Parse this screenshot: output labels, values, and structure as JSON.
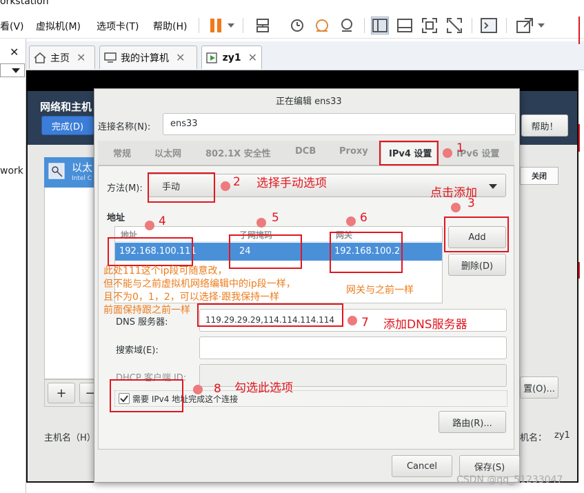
{
  "app_title": "orkstation",
  "menu": [
    {
      "label": "看(V)"
    },
    {
      "label": "虚拟机(M)"
    },
    {
      "label": "选项卡(T)"
    },
    {
      "label": "帮助(H)"
    }
  ],
  "toolbar_icons": [
    "pause-icon",
    "dropdown-icon",
    "send-keys-icon",
    "snapshot-icon",
    "revert-snapshot-icon",
    "snapshot-manager-icon",
    "sidebar-view-icon",
    "thumbnail-view-icon",
    "fullscreen-icon",
    "unity-icon",
    "console-icon",
    "stretch-icon",
    "dropdown-icon"
  ],
  "tabs": [
    {
      "label": "主页"
    },
    {
      "label": "我的计算机"
    },
    {
      "label": "zy1"
    }
  ],
  "left_text": "work",
  "settings_panel": {
    "header_title": "网络和主机",
    "done_button": "完成(D)",
    "help_button": "帮助！",
    "device_name": "以太",
    "device_sub": "Intel C",
    "close_label": "关闭",
    "hostname_label": "主机名（H）",
    "hostname_suffix": "机名：",
    "hostname_value": "zy1",
    "configure_button": "置(O)...",
    "add_button": "+",
    "remove_button": "−"
  },
  "dialog": {
    "title": "正在编辑 ens33",
    "connection_name_label": "连接名称(N):",
    "connection_name_value": "ens33",
    "tabs": [
      "常规",
      "以太网",
      "802.1X 安全性",
      "DCB",
      "Proxy",
      "IPv4 设置",
      "IPv6 设置"
    ],
    "active_tab": "IPv4 设置",
    "method_label": "方法(M):",
    "method_value": "手动",
    "address_section": "地址",
    "columns": [
      "地址",
      "子网掩码",
      "网关"
    ],
    "address_row": {
      "address": "192.168.100.111",
      "netmask": "24",
      "gateway": "192.168.100.2"
    },
    "add_button": "Add",
    "delete_button": "删除(D)",
    "dns_label": "DNS 服务器:",
    "dns_value": "119.29.29.29,114.114.114.114",
    "search_label": "搜索域(E):",
    "dhcp_label": "DHCP 客户端 ID:",
    "require_ipv4_label": "需要 IPv4 地址完成这个连接",
    "require_ipv4_checked": true,
    "routes_button": "路由(R)...",
    "cancel_button": "Cancel",
    "save_button": "保存(S)"
  },
  "annotations": {
    "n1": "1",
    "n2": "2",
    "n3": "3",
    "n4": "4",
    "n5": "5",
    "n6": "6",
    "n7": "7",
    "n8": "8",
    "choose_manual": "选择手动选项",
    "click_add": "点击添加",
    "ip_note_1": "此处111这个ip段可随意改，",
    "ip_note_2": "但不能与之前虚拟机网络编辑中的ip段一样，",
    "ip_note_3": "且不为0，1，2，可以选择·跟我保持一样",
    "ip_note_4": "前面保持跟之前一样",
    "gateway_note": "网关与之前一样",
    "add_dns": "添加DNS服务器",
    "check_option": "勾选此选项"
  },
  "watermark": "CSDN @qq_51233047",
  "colors": {
    "annotation_red": "#e0161e",
    "annotation_orange": "#ec7c1c",
    "selection_blue": "#4a90d9",
    "header_navy": "#2c3e55",
    "done_blue": "#3b7dd8"
  }
}
